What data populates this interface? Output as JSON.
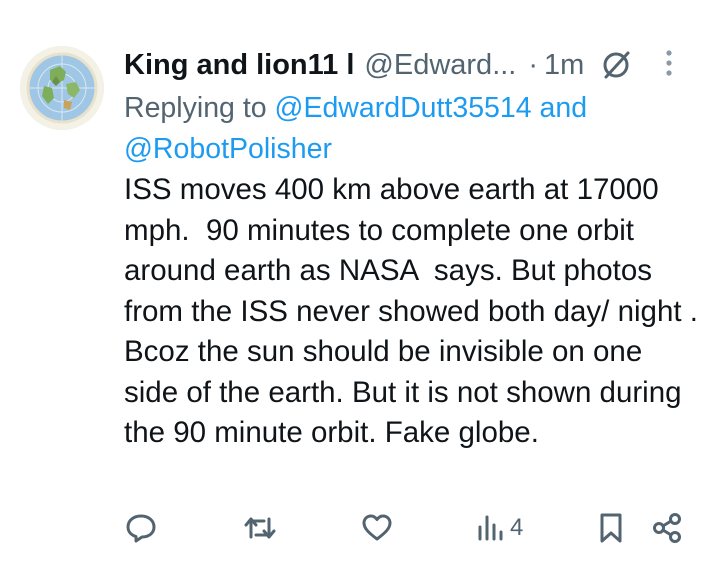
{
  "tweet": {
    "author": {
      "display_name": "King and lion11 l",
      "handle": "@Edward...",
      "avatar_icon": "flat-earth-map-avatar"
    },
    "time_separator": "·",
    "time": "1m",
    "reply": {
      "prefix": "Replying to",
      "mention1": "@EdwardDutt35514",
      "conjunction": "and",
      "mention2": "@RobotPolisher"
    },
    "text": "ISS moves 400 km above earth at 17000 mph.  90 minutes to complete one orbit around earth as NASA  says. But photos from the ISS never showed both day/ night . Bcoz the sun should be invisible on one side of the earth. But it is not shown during the 90 minute orbit. Fake globe."
  },
  "actions": {
    "views_count": "4"
  },
  "colors": {
    "text": "#0f1419",
    "secondary": "#536471",
    "link": "#1d9bf0"
  }
}
